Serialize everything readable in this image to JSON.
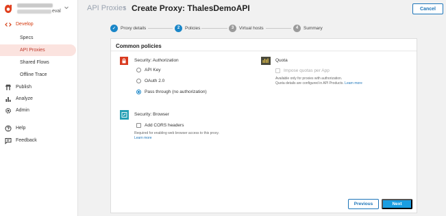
{
  "org": {
    "suffix": "eval"
  },
  "sidebar": {
    "develop": "Develop",
    "develop_items": [
      "Specs",
      "API Proxies",
      "Shared Flows",
      "Offline Trace"
    ],
    "publish": "Publish",
    "analyze": "Analyze",
    "admin": "Admin",
    "help": "Help",
    "feedback": "Feedback"
  },
  "header": {
    "breadcrumb": "API Proxies",
    "separator": "›",
    "title": "Create Proxy: ThalesDemoAPI",
    "cancel": "Cancel"
  },
  "stepper": {
    "steps": [
      {
        "num": "✓",
        "label": "Proxy details",
        "state": "done"
      },
      {
        "num": "2",
        "label": "Policies",
        "state": "current"
      },
      {
        "num": "3",
        "label": "Virtual hosts",
        "state": "todo"
      },
      {
        "num": "4",
        "label": "Summary",
        "state": "todo"
      }
    ]
  },
  "policies": {
    "heading": "Common policies",
    "authorization": {
      "title": "Security: Authorization",
      "options": [
        "API Key",
        "OAuth 2.0",
        "Pass through (no authorization)"
      ],
      "selected": "Pass through (no authorization)"
    },
    "quota": {
      "title": "Quota",
      "checkbox": "Impose quotas per App",
      "note_line1": "Available only for proxies with authorization.",
      "note_line2": "Quota details are configured in API Products.",
      "learn_more": "Learn more"
    },
    "browser": {
      "title": "Security: Browser",
      "checkbox": "Add CORS headers",
      "note": "Required for enabling web browser access to this proxy.",
      "learn_more": "Learn more"
    }
  },
  "footer": {
    "previous": "Previous",
    "next": "Next"
  },
  "colors": {
    "accent": "#1a86c8",
    "brand": "#e0401e",
    "selected_bg": "#fbe3df"
  }
}
